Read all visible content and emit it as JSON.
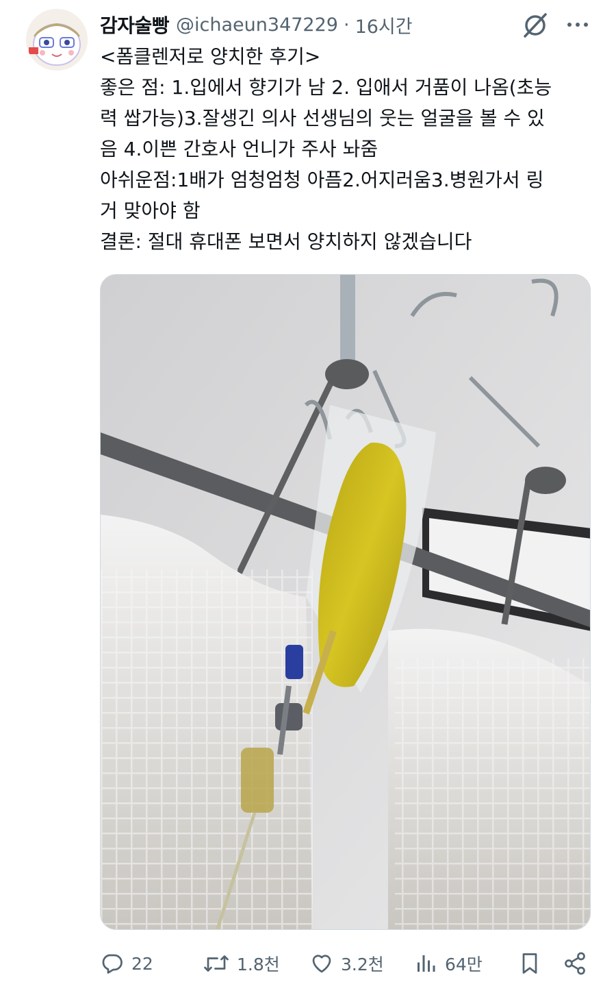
{
  "author": {
    "display_name": "감자술빵",
    "handle": "@ichaeun347229",
    "separator": "·",
    "time": "16시간"
  },
  "tweet": {
    "lines": [
      "<폼클렌저로 양치한 후기>",
      "좋은 점: 1.입에서 향기가 남 2. 입애서 거품이 나옴(초능",
      "력 쌉가능)3.잘생긴 의사 선생님의 웃는 얼굴을 볼 수 있",
      "음 4.이쁜 간호사 언니가 주사 놔줌",
      "아쉬운점:1배가 엄청엄청 아픔2.어지러움3.병원가서 링",
      "거 맞아야 함",
      "결론: 절대 휴대폰 보면서 양치하지 않겠습니다"
    ]
  },
  "media": {
    "description_icon": "photo"
  },
  "actions": {
    "replies": "22",
    "retweets": "1.8천",
    "likes": "3.2천",
    "views": "64만"
  },
  "icons": {
    "grok": "grok-icon",
    "more": "more-icon",
    "reply": "reply-icon",
    "retweet": "retweet-icon",
    "like": "heart-icon",
    "views": "views-icon",
    "bookmark": "bookmark-icon",
    "share": "share-icon"
  },
  "colors": {
    "text": "#0f1419",
    "secondary": "#536471",
    "border": "#cfd9de",
    "iv_fluid": "#c8b418"
  }
}
